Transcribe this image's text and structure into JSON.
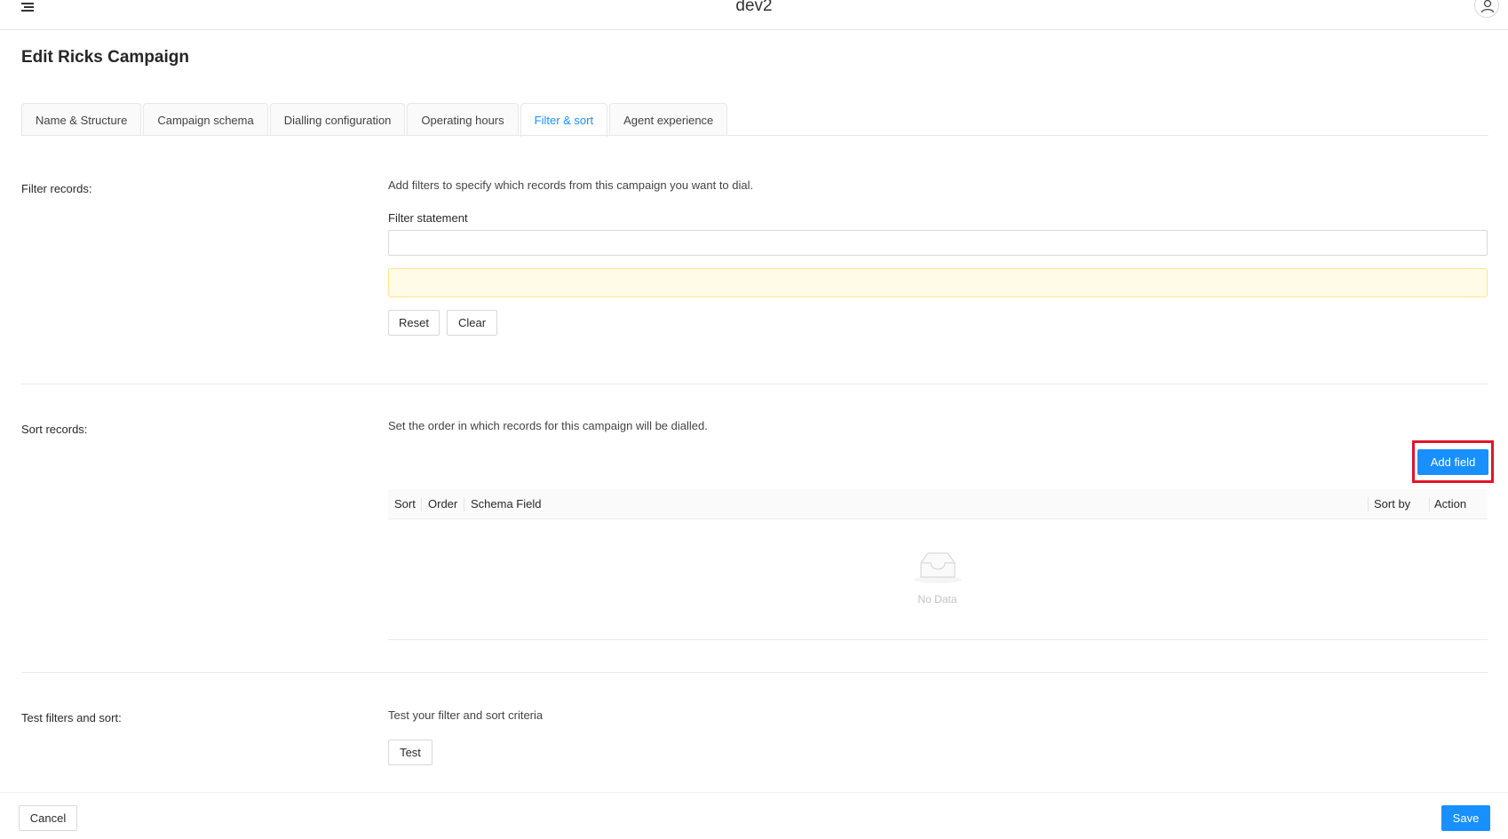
{
  "header": {
    "app_title": "dev2",
    "menu_icon": "hamburger-menu-icon",
    "user_icon": "user-icon"
  },
  "page": {
    "title": "Edit Ricks Campaign"
  },
  "tabs": [
    {
      "label": "Name & Structure",
      "active": false
    },
    {
      "label": "Campaign schema",
      "active": false
    },
    {
      "label": "Dialling configuration",
      "active": false
    },
    {
      "label": "Operating hours",
      "active": false
    },
    {
      "label": "Filter & sort",
      "active": true
    },
    {
      "label": "Agent experience",
      "active": false
    }
  ],
  "filter": {
    "label": "Filter records:",
    "description": "Add filters to specify which records from this campaign you want to dial.",
    "statement_label": "Filter statement",
    "statement_value": "",
    "reset_label": "Reset",
    "clear_label": "Clear"
  },
  "sort": {
    "label": "Sort records:",
    "description": "Set the order in which records for this campaign will be dialled.",
    "add_field_label": "Add field",
    "columns": [
      "Sort",
      "Order",
      "Schema Field",
      "Sort by",
      "Action"
    ],
    "rows": [],
    "empty_text": "No Data",
    "empty_icon": "empty-inbox-icon"
  },
  "test": {
    "label": "Test filters and sort:",
    "description": "Test your filter and sort criteria",
    "test_label": "Test"
  },
  "footer": {
    "cancel_label": "Cancel",
    "save_label": "Save"
  },
  "colors": {
    "primary": "#1890ff",
    "highlight": "#e0142a",
    "warning_bg": "#fffbe6"
  }
}
